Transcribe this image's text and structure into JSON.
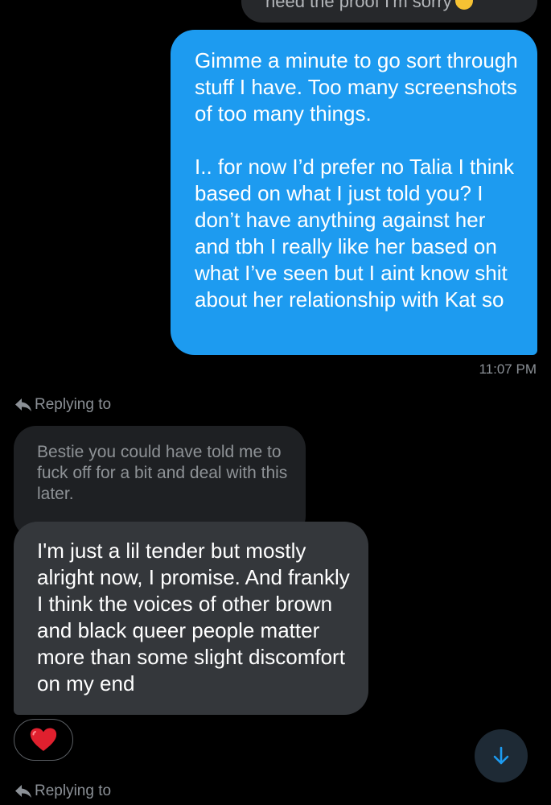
{
  "previous_message": {
    "text": "need the proof I'm sorry",
    "emoji": "fearful-face-emoji"
  },
  "outgoing_message": {
    "paragraphs": [
      "Gimme a minute to go sort through stuff I have. Too many screenshots of too many things.",
      "I.. for now I’d prefer no Talia I think based on what I just told you? I don’t have anything against her and tbh I really like her based on what I’ve seen but I aint know shit about her relationship with Kat so"
    ],
    "timestamp": "11:07 PM",
    "color": "#1d9bf0"
  },
  "reply_context": {
    "label": "Replying to",
    "quoted_text": "Bestie you could have told me to fuck off for a bit and deal with this later."
  },
  "incoming_message": {
    "text": "I'm just a lil tender but mostly alright now, I promise. And frankly I think the voices of other brown and black queer people matter more than some slight discomfort on my end",
    "reaction": "red-heart-emoji"
  },
  "next_reply_context": {
    "label": "Replying to"
  },
  "scroll_button": {
    "icon": "arrow-down-icon",
    "color": "#1d9bf0"
  }
}
